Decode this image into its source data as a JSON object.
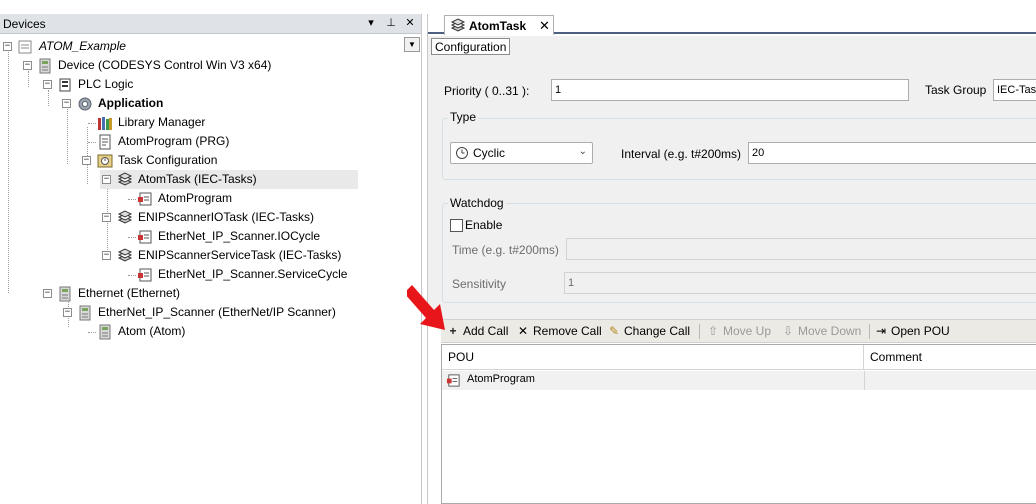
{
  "devices_panel": {
    "title": "Devices",
    "header_buttons": [
      "▾",
      "⊥",
      "✕"
    ],
    "tree": [
      {
        "label": "ATOM_Example",
        "italic": true
      },
      {
        "label": "Device (CODESYS Control Win V3 x64)"
      },
      {
        "label": "PLC Logic"
      },
      {
        "label": "Application",
        "bold": true
      },
      {
        "label": "Library Manager"
      },
      {
        "label": "AtomProgram (PRG)"
      },
      {
        "label": "Task Configuration"
      },
      {
        "label": "AtomTask (IEC-Tasks)",
        "selected": true
      },
      {
        "label": "AtomProgram"
      },
      {
        "label": "ENIPScannerIOTask (IEC-Tasks)"
      },
      {
        "label": "EtherNet_IP_Scanner.IOCycle"
      },
      {
        "label": "ENIPScannerServiceTask (IEC-Tasks)"
      },
      {
        "label": "EtherNet_IP_Scanner.ServiceCycle"
      },
      {
        "label": "Ethernet (Ethernet)"
      },
      {
        "label": "EtherNet_IP_Scanner (EtherNet/IP Scanner)"
      },
      {
        "label": "Atom (Atom)"
      }
    ]
  },
  "editor": {
    "tab": {
      "label": "AtomTask",
      "close": "✕"
    },
    "subtab": "Configuration",
    "priority": {
      "label": "Priority ( 0..31 ):",
      "value": "1"
    },
    "task_group": {
      "label": "Task Group",
      "value": "IEC-Tasks"
    },
    "type_group": {
      "title": "Type",
      "selected": "Cyclic",
      "interval_label": "Interval (e.g. t#200ms)",
      "interval_value": "20"
    },
    "watchdog_group": {
      "title": "Watchdog",
      "enable_label": "Enable",
      "enable_checked": false,
      "time_label": "Time (e.g. t#200ms)",
      "time_value": "",
      "sensitivity_label": "Sensitivity",
      "sensitivity_value": "1"
    },
    "toolbar": {
      "add_call": "Add Call",
      "remove_call": "Remove Call",
      "change_call": "Change Call",
      "move_up": "Move Up",
      "move_down": "Move Down",
      "open_pou": "Open POU"
    },
    "grid": {
      "columns": [
        "POU",
        "Comment"
      ],
      "rows": [
        {
          "pou": "AtomProgram",
          "comment": ""
        }
      ]
    }
  },
  "colors": {
    "header_bg": "#dfe3e8",
    "tab_underline": "#4d6082",
    "panel_bg": "#f0f0f0",
    "selection": "#e9e9e9",
    "annotation_arrow": "#e8161b"
  }
}
